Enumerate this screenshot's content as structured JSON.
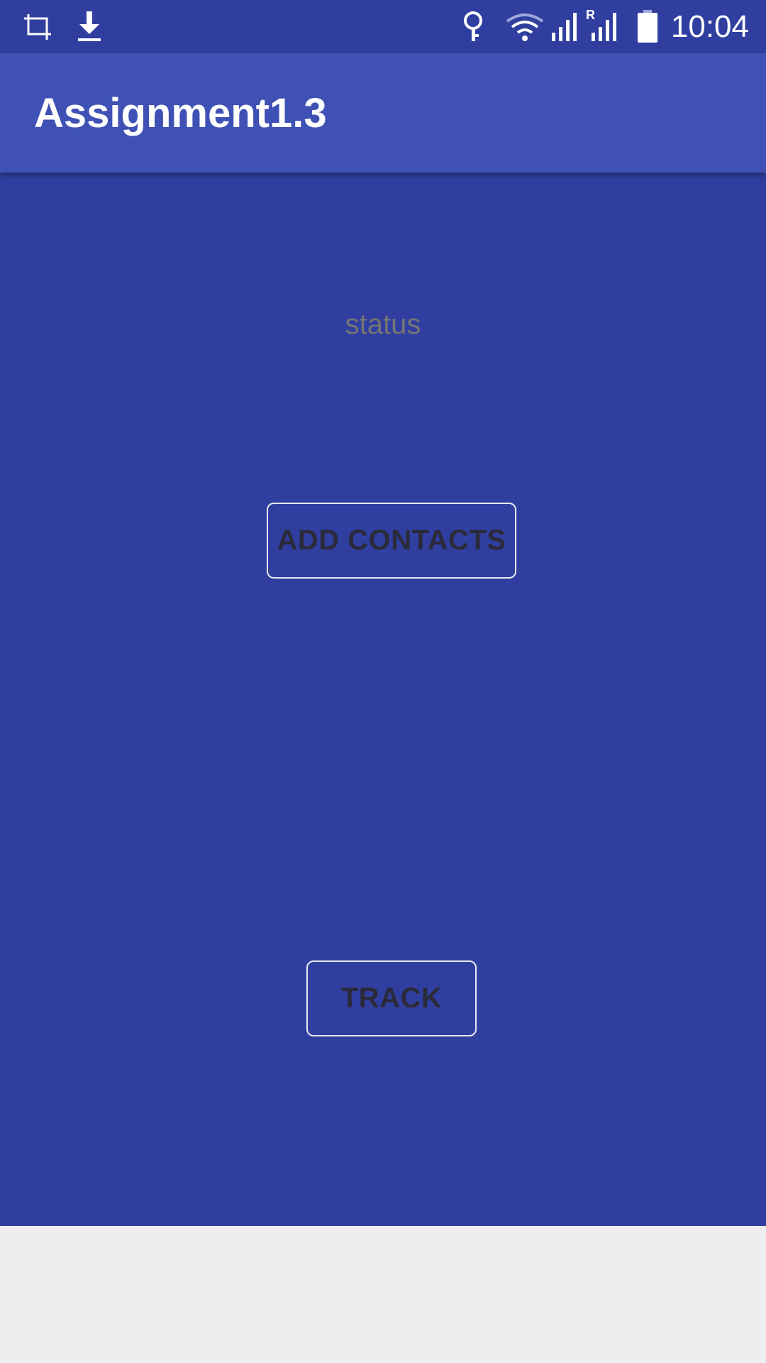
{
  "status_bar": {
    "time": "10:04",
    "left_icons": [
      "crop-icon",
      "download-icon"
    ],
    "right_icons": [
      "key-icon",
      "wifi-icon",
      "cell-signal-icon",
      "roaming-signal-icon",
      "battery-icon"
    ],
    "roaming_label": "R"
  },
  "app_bar": {
    "title": "Assignment1.3"
  },
  "main": {
    "status_label": "status",
    "add_contacts_label": "ADD CONTACTS",
    "track_label": "TRACK"
  },
  "colors": {
    "status_bar": "#303f9f",
    "app_bar": "#3f51b5",
    "content_background": "#303f9f",
    "status_text": "#757575",
    "button_text": "#2a2a3a",
    "bottom_area": "#eeeeee"
  }
}
